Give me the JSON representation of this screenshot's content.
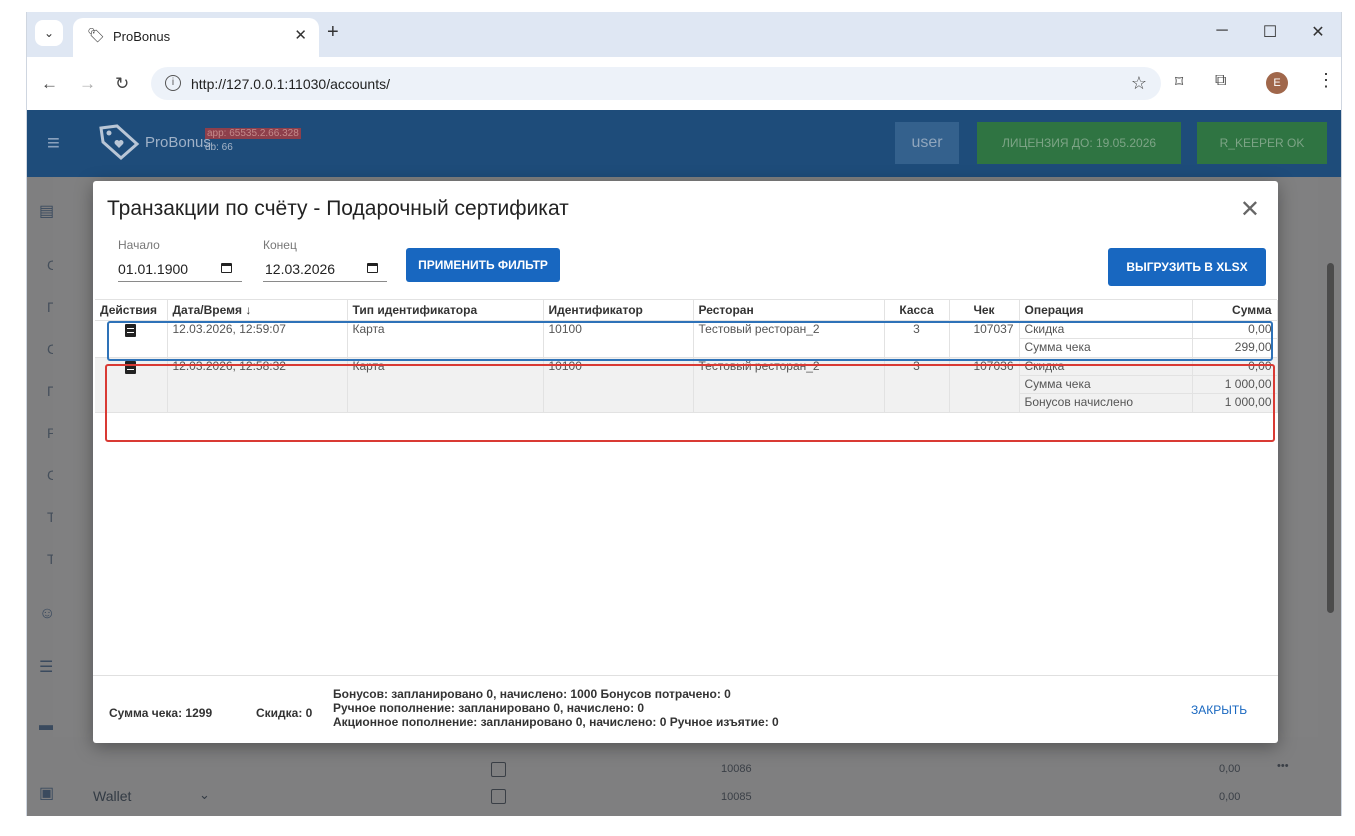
{
  "browser": {
    "tab_title": "ProBonus",
    "url": "http://127.0.0.1:11030/accounts/",
    "avatar_letter": "E"
  },
  "appbar": {
    "logo_text": "ProBonus",
    "app_version": "app: 65535.2.66.328",
    "db": "db: 66",
    "user_label": "user",
    "license_label": "ЛИЦЕНЗИЯ ДО: 19.05.2026",
    "rkeeper_label": "R_KEEPER OK"
  },
  "background": {
    "wallet_label": "Wallet",
    "rows": [
      {
        "id": "10086",
        "sum": "0,00"
      },
      {
        "id": "10085",
        "sum": "0,00"
      }
    ]
  },
  "dialog": {
    "title": "Транзакции по счёту - Подарочный сертификат",
    "start_label": "Начало",
    "start_value": "01.01.1900",
    "end_label": "Конец",
    "end_value": "12.03.2026",
    "apply_button": "ПРИМЕНИТЬ ФИЛЬТР",
    "export_button": "ВЫГРУЗИТЬ В XLSX",
    "close_button": "ЗАКРЫТЬ",
    "columns": {
      "actions": "Действия",
      "datetime": "Дата/Время ↓",
      "id_type": "Тип идентификатора",
      "identifier": "Идентификатор",
      "restaurant": "Ресторан",
      "cash": "Касса",
      "check": "Чек",
      "operation": "Операция",
      "sum": "Сумма"
    },
    "rows": [
      {
        "datetime": "12.03.2026, 12:59:07",
        "id_type": "Карта",
        "identifier": "10100",
        "restaurant": "Тестовый ресторан_2",
        "cash": "3",
        "check": "107037",
        "ops": [
          {
            "name": "Скидка",
            "sum": "0,00"
          },
          {
            "name": "Сумма чека",
            "sum": "299,00"
          }
        ]
      },
      {
        "datetime": "12.03.2026, 12:58:32",
        "id_type": "Карта",
        "identifier": "10100",
        "restaurant": "Тестовый ресторан_2",
        "cash": "3",
        "check": "107036",
        "ops": [
          {
            "name": "Скидка",
            "sum": "0,00"
          },
          {
            "name": "Сумма чека",
            "sum": "1 000,00"
          },
          {
            "name": "Бонусов начислено",
            "sum": "1 000,00"
          }
        ]
      }
    ],
    "footer": {
      "check_sum": "Сумма чека: 1299",
      "discount": "Скидка: 0",
      "bonuses": "Бонусов: запланировано 0, начислено: 1000   Бонусов потрачено: 0",
      "manual": "Ручное пополнение: запланировано 0, начислено: 0",
      "promo": "Акционное пополнение: запланировано 0, начислено: 0    Ручное изъятие: 0"
    }
  }
}
